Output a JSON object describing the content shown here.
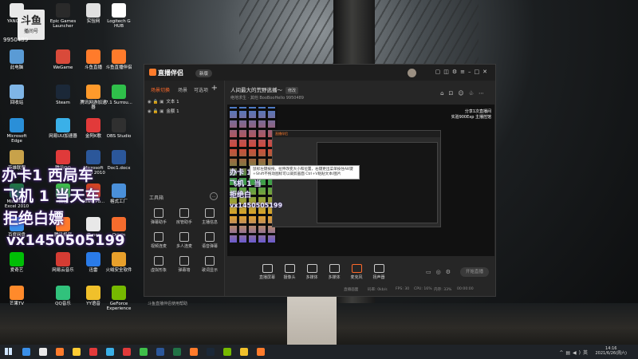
{
  "desktop": {
    "logo_badge": {
      "big": "斗鱼",
      "small": "播间号"
    },
    "badge_number": "9950489",
    "icons": [
      {
        "label": "YANGSHI",
        "color": "#e8e8e8"
      },
      {
        "label": "Epic Games Launcher",
        "color": "#2a2a2a"
      },
      {
        "label": "实验网",
        "color": "#e0e0e0"
      },
      {
        "label": "Logitech G HUB",
        "color": "#ffffff"
      },
      {
        "label": "此电脑",
        "color": "#5a9bd5"
      },
      {
        "label": "WeGame",
        "color": "#d94a3a"
      },
      {
        "label": "斗鱼直播",
        "color": "#ff7b2b"
      },
      {
        "label": "斗鱼直播伴侣",
        "color": "#ff7b2b"
      },
      {
        "label": "回收站",
        "color": "#7fb5e6"
      },
      {
        "label": "Steam",
        "color": "#1b2838"
      },
      {
        "label": "腾讯网游加速器",
        "color": "#ff9a2b"
      },
      {
        "label": "7.1 Surrou...",
        "color": "#2fbf4a"
      },
      {
        "label": "Microsoft Edge",
        "color": "#2a8fd8"
      },
      {
        "label": "网易UU加速器",
        "color": "#3ab0e8"
      },
      {
        "label": "金阿K歌",
        "color": "#e23a3a"
      },
      {
        "label": "OBS Studio",
        "color": "#303030"
      },
      {
        "label": "英雄联盟",
        "color": "#c8a24a"
      },
      {
        "label": "腾讯QQ",
        "color": "#e03a3a"
      },
      {
        "label": "Microsoft Word 2010",
        "color": "#2b579a"
      },
      {
        "label": "Doc1.docx",
        "color": "#2b579a"
      },
      {
        "label": "Microsoft Excel 2010",
        "color": "#217346"
      },
      {
        "label": "微信",
        "color": "#3fbf4a"
      },
      {
        "label": "PowerPo...",
        "color": "#d04423"
      },
      {
        "label": "格式工厂",
        "color": "#4a90d9"
      },
      {
        "label": "百度网盘",
        "color": "#3a8fe8"
      },
      {
        "label": "腾讯视频",
        "color": "#ff7a2b"
      },
      {
        "label": "iTunes",
        "color": "#e8e8e8"
      },
      {
        "label": "Origin",
        "color": "#f56c2d"
      },
      {
        "label": "爱奇艺",
        "color": "#00be06"
      },
      {
        "label": "网易云音乐",
        "color": "#d43c33"
      },
      {
        "label": "迅雷",
        "color": "#2a7be8"
      },
      {
        "label": "火绒安全软件",
        "color": "#e8a02b"
      },
      {
        "label": "芒果TV",
        "color": "#ff8a2b"
      },
      {
        "label": "QQ音乐",
        "color": "#31c27c"
      },
      {
        "label": "YY语音",
        "color": "#f0c02b"
      },
      {
        "label": "GeForce Experience",
        "color": "#76b900"
      }
    ],
    "overlay_lines": [
      "办卡1 西局车",
      "飞机 1 当天车",
      "拒绝白嫖",
      "vx1450505199"
    ]
  },
  "app": {
    "name": "直播伴侣",
    "version": "新版",
    "left": {
      "tabs": [
        "场景切换",
        "场景",
        "可选项"
      ],
      "sources": [
        "文本 1",
        "金额 1"
      ],
      "toolbox_title": "工具箱",
      "tools": [
        {
          "label": "弹幕助手"
        },
        {
          "label": "房管助手"
        },
        {
          "label": "主播信息"
        },
        {
          "label": "视频连麦"
        },
        {
          "label": "多人连麦"
        },
        {
          "label": "语音弹幕"
        },
        {
          "label": "虚拟形象"
        },
        {
          "label": "弹幕墙"
        },
        {
          "label": "歌词显示"
        }
      ],
      "status": "斗鱼直播伴侣使用帮助"
    },
    "room": {
      "title": "人间最大的荒野逃播～",
      "tag": "修改",
      "subtitle": "绝地求生 · 其他    BooBooHello  9950489"
    },
    "preview": {
      "sponsor_lines": [
        "分享1次直播间",
        "实验900Exp 主播控馆"
      ],
      "tooltip": "鼠标左键按拖，拉伸改变大小和位置，右键更出菜单按住Alt键+Shift不拖动图标可以裁剪画面 Ctrl+V粘贴文本/图片",
      "overlay_lines": [
        "办卡 1 西",
        "飞机 1 当",
        "拒绝白",
        "vx1450505199"
      ]
    },
    "controls": [
      {
        "label": "直播屏幕"
      },
      {
        "label": "摄像头"
      },
      {
        "label": "多媒体"
      },
      {
        "label": "多媒体"
      },
      {
        "label": "麦克风"
      },
      {
        "label": "扬声器"
      }
    ],
    "go_live": "开始直播",
    "statusbar": [
      "直播画面",
      "码率: 0kb/s",
      "FPS: 30",
      "CPU: 16%",
      "内存: 33%",
      "00:00:00"
    ]
  },
  "taskbar": {
    "time": "14:16",
    "date": "2021/6/26(周六)",
    "apps": [
      "#3a8fe8",
      "#e8e8e8",
      "#ff7b2b",
      "#ffcc33",
      "#e23a3a",
      "#3ab0e8",
      "#e03a3a",
      "#3fbf4a",
      "#2b579a",
      "#217346",
      "#ff7b2b",
      "#1b2838",
      "#76b900",
      "#f0c02b",
      "#ff7b2b"
    ]
  }
}
